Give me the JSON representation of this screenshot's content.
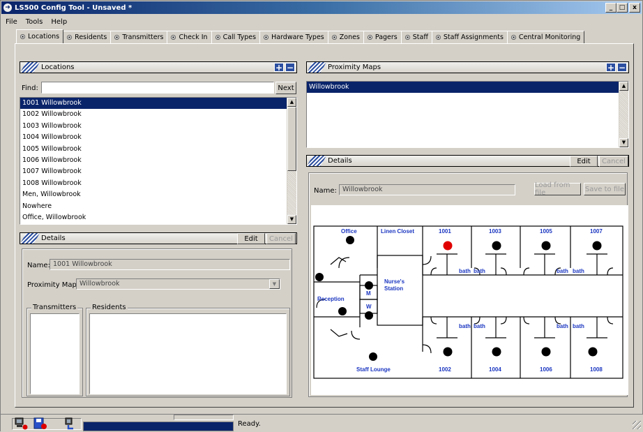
{
  "window": {
    "title": "LS500 Config Tool - Unsaved *"
  },
  "window_controls": {
    "minimize": "_",
    "maximize": "□",
    "close": "x"
  },
  "menu": [
    "File",
    "Tools",
    "Help"
  ],
  "tabs": [
    "Locations",
    "Residents",
    "Transmitters",
    "Check In",
    "Call Types",
    "Hardware Types",
    "Zones",
    "Pagers",
    "Staff",
    "Staff Assignments",
    "Central Monitoring"
  ],
  "active_tab": "Locations",
  "locations_panel": {
    "title": "Locations",
    "add": "+",
    "remove": "−",
    "find_label": "Find:",
    "find_value": "",
    "next_button": "Next",
    "items": [
      "1001 Willowbrook",
      "1002 Willowbrook",
      "1003 Willowbrook",
      "1004 Willowbrook",
      "1005 Willowbrook",
      "1006 Willowbrook",
      "1007 Willowbrook",
      "1008 Willowbrook",
      "Men, Willowbrook",
      "Nowhere",
      "Office, Willowbrook"
    ],
    "selected": "1001 Willowbrook"
  },
  "location_details": {
    "title": "Details",
    "edit": "Edit",
    "cancel": "Cancel",
    "name_label": "Name:",
    "name_value": "1001 Willowbrook",
    "map_label": "Proximity Map:",
    "map_value": "Willowbrook",
    "transmitters_label": "Transmitters",
    "residents_label": "Residents"
  },
  "proximity_panel": {
    "title": "Proximity Maps",
    "add": "+",
    "remove": "−",
    "items": [
      "Willowbrook"
    ],
    "selected": "Willowbrook"
  },
  "map_details": {
    "title": "Details",
    "edit": "Edit",
    "cancel": "Cancel",
    "name_label": "Name:",
    "name_value": "Willowbrook",
    "load_button": "Load from file",
    "save_button": "Save to file"
  },
  "floorplan": {
    "labels": {
      "office": "Office",
      "linen": "Linen Closet",
      "nurse1": "Nurse's",
      "nurse2": "Station",
      "reception": "Reception",
      "staff": "Staff Lounge",
      "m": "M",
      "w": "W",
      "bath": "bath"
    },
    "top_rooms": [
      "1001",
      "1003",
      "1005",
      "1007"
    ],
    "bottom_rooms": [
      "1002",
      "1004",
      "1006",
      "1008"
    ],
    "highlight_color": "#e00000",
    "marker_color": "#000000",
    "label_color": "#1a35c0"
  },
  "status": {
    "text": "Ready."
  }
}
